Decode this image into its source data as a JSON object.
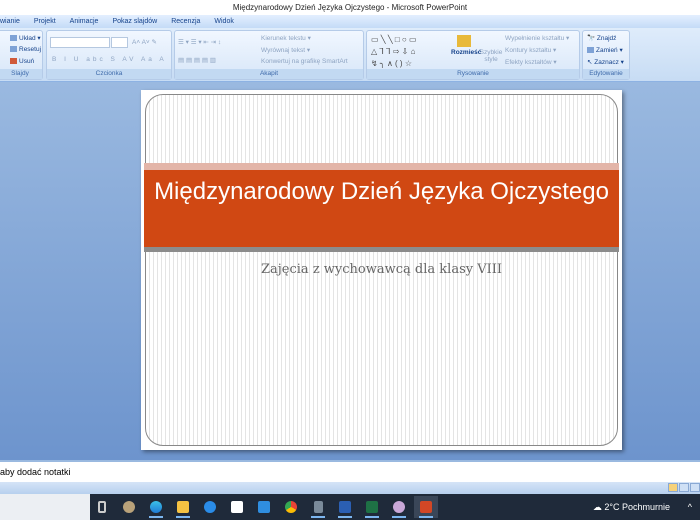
{
  "window": {
    "title": "Międzynarodowy Dzień Języka Ojczystego - Microsoft PowerPoint"
  },
  "tabs": [
    "wianie",
    "Projekt",
    "Animacje",
    "Pokaz slajdów",
    "Recenzja",
    "Widok"
  ],
  "ribbon": {
    "slajdy": {
      "label": "Slajdy",
      "uklad": "Układ",
      "resetuj": "Resetuj",
      "usun": "Usuń"
    },
    "czcionka": {
      "label": "Czcionka"
    },
    "akapit": {
      "label": "Akapit",
      "kierunek": "Kierunek tekstu",
      "wyrownaj": "Wyrównaj tekst",
      "konwertuj": "Konwertuj na grafikę SmartArt"
    },
    "rysowanie": {
      "label": "Rysowanie",
      "rozmiesc": "Rozmieść",
      "szybkie": "Szybkie style",
      "wypelnienie": "Wypełnienie kształtu",
      "kontury": "Kontury kształtu",
      "efekty": "Efekty kształtów"
    },
    "edytowanie": {
      "label": "Edytowanie",
      "znajdz": "Znajdź",
      "zamien": "Zamień",
      "zaznacz": "Zaznacz"
    }
  },
  "slide": {
    "title": "Międzynarodowy Dzień Języka Ojczystego",
    "subtitle": "Zajęcia z wychowawcą dla klasy VIII",
    "accent": "#d04813"
  },
  "notes": {
    "placeholder": "aby dodać notatki"
  },
  "taskbar": {
    "icons": [
      "task-view",
      "media-app",
      "edge",
      "file-explorer",
      "app-blue",
      "store",
      "mail",
      "chrome",
      "calculator",
      "word",
      "excel",
      "paint-app",
      "powerpoint"
    ],
    "weather": "2°C  Pochmurnie"
  }
}
